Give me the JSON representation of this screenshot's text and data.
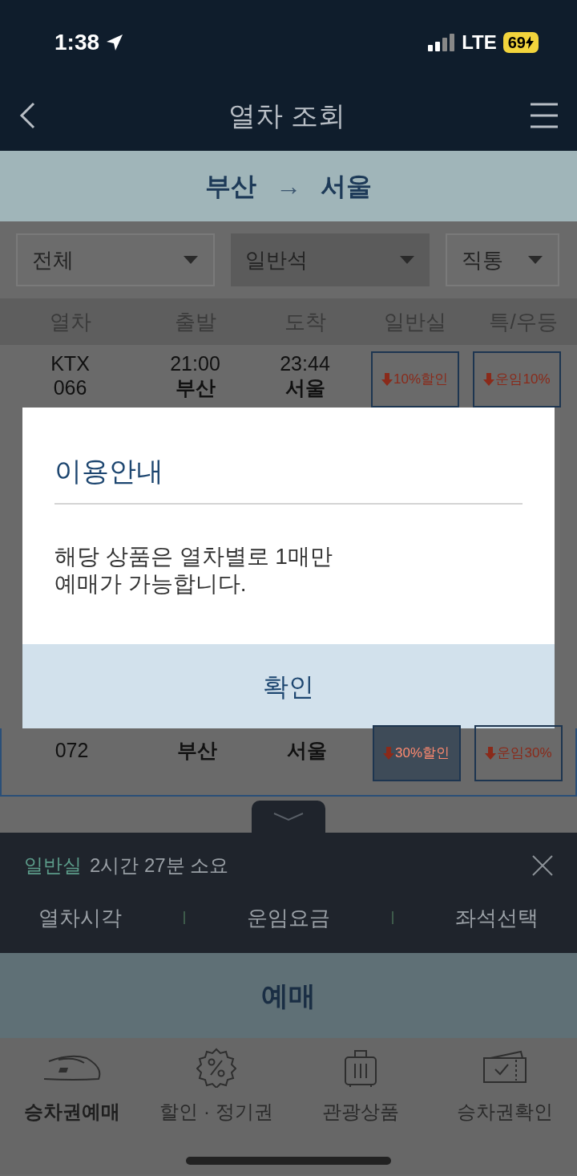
{
  "status_bar": {
    "time": "1:38",
    "network": "LTE",
    "battery": "69"
  },
  "header": {
    "title": "열차 조회"
  },
  "route": {
    "from": "부산",
    "arrow": "→",
    "to": "서울"
  },
  "filters": [
    {
      "label": "전체",
      "selected": false
    },
    {
      "label": "일반석",
      "selected": true
    },
    {
      "label": "직통",
      "selected": false
    }
  ],
  "columns": [
    "열차",
    "출발",
    "도착",
    "일반실",
    "특/우등"
  ],
  "trains": [
    {
      "train_type": "KTX",
      "train_number": "066",
      "depart_time": "21:00",
      "depart_station": "부산",
      "arrive_time": "23:44",
      "arrive_station": "서울",
      "standard": {
        "label": "10%할인",
        "selected": false
      },
      "premium": {
        "label": "운임10%",
        "selected": false
      },
      "selected": false
    },
    {
      "train_number": "072",
      "depart_station": "부산",
      "arrive_station": "서울",
      "standard": {
        "label": "30%할인",
        "selected": true
      },
      "premium": {
        "label": "운임30%",
        "selected": false
      },
      "selected": true
    }
  ],
  "dialog": {
    "title": "이용안내",
    "message": "해당 상품은 열차별로 1매만\n예매가 가능합니다.",
    "confirm": "확인"
  },
  "summary": {
    "seat_class": "일반실",
    "duration": "2시간 27분 소요",
    "tabs": [
      "열차시각",
      "운임요금",
      "좌석선택"
    ]
  },
  "book_button": "예매",
  "nav": [
    {
      "kind": "train",
      "label": "승차권예매",
      "selected": true
    },
    {
      "kind": "discount",
      "label": "할인 · 정기권",
      "selected": false
    },
    {
      "kind": "luggage",
      "label": "관광상품",
      "selected": false
    },
    {
      "kind": "ticket",
      "label": "승차권확인",
      "selected": false
    }
  ]
}
